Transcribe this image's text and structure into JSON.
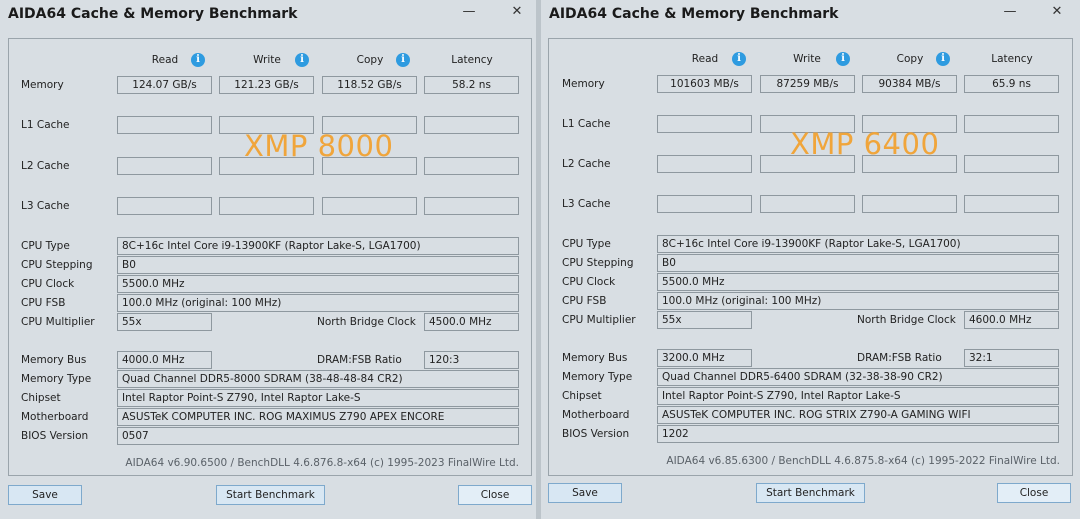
{
  "left": {
    "title": "AIDA64 Cache & Memory Benchmark",
    "minimize_glyph": "—",
    "close_glyph": "✕",
    "headers": {
      "read": "Read",
      "write": "Write",
      "copy": "Copy",
      "latency": "Latency"
    },
    "info_glyph": "i",
    "rows": {
      "memory": "Memory",
      "l1": "L1 Cache",
      "l2": "L2 Cache",
      "l3": "L3 Cache"
    },
    "memory": {
      "read": "124.07 GB/s",
      "write": "121.23 GB/s",
      "copy": "118.52 GB/s",
      "latency": "58.2 ns"
    },
    "overlay": "XMP 8000",
    "info_labels": {
      "cpu_type": "CPU Type",
      "cpu_stepping": "CPU Stepping",
      "cpu_clock": "CPU Clock",
      "cpu_fsb": "CPU FSB",
      "cpu_multiplier": "CPU Multiplier",
      "north_bridge": "North Bridge Clock",
      "memory_bus": "Memory Bus",
      "dram_fsb": "DRAM:FSB Ratio",
      "memory_type": "Memory Type",
      "chipset": "Chipset",
      "motherboard": "Motherboard",
      "bios": "BIOS Version"
    },
    "info_values": {
      "cpu_type": "8C+16c Intel Core i9-13900KF  (Raptor Lake-S, LGA1700)",
      "cpu_stepping": "B0",
      "cpu_clock": "5500.0 MHz",
      "cpu_fsb": "100.0 MHz  (original: 100 MHz)",
      "cpu_multiplier": "55x",
      "north_bridge": "4500.0 MHz",
      "memory_bus": "4000.0 MHz",
      "dram_fsb": "120:3",
      "memory_type": "Quad Channel DDR5-8000 SDRAM  (38-48-48-84 CR2)",
      "chipset": "Intel Raptor Point-S Z790, Intel Raptor Lake-S",
      "motherboard": "ASUSTeK COMPUTER INC. ROG MAXIMUS Z790 APEX ENCORE",
      "bios": "0507"
    },
    "footer": "AIDA64 v6.90.6500 / BenchDLL 4.6.876.8-x64  (c) 1995-2023 FinalWire Ltd.",
    "buttons": {
      "save": "Save",
      "start": "Start Benchmark",
      "close": "Close"
    }
  },
  "right": {
    "title": "AIDA64 Cache & Memory Benchmark",
    "minimize_glyph": "—",
    "close_glyph": "✕",
    "headers": {
      "read": "Read",
      "write": "Write",
      "copy": "Copy",
      "latency": "Latency"
    },
    "info_glyph": "i",
    "rows": {
      "memory": "Memory",
      "l1": "L1 Cache",
      "l2": "L2 Cache",
      "l3": "L3 Cache"
    },
    "memory": {
      "read": "101603 MB/s",
      "write": "87259 MB/s",
      "copy": "90384 MB/s",
      "latency": "65.9 ns"
    },
    "overlay": "XMP 6400",
    "info_labels": {
      "cpu_type": "CPU Type",
      "cpu_stepping": "CPU Stepping",
      "cpu_clock": "CPU Clock",
      "cpu_fsb": "CPU FSB",
      "cpu_multiplier": "CPU Multiplier",
      "north_bridge": "North Bridge Clock",
      "memory_bus": "Memory Bus",
      "dram_fsb": "DRAM:FSB Ratio",
      "memory_type": "Memory Type",
      "chipset": "Chipset",
      "motherboard": "Motherboard",
      "bios": "BIOS Version"
    },
    "info_values": {
      "cpu_type": "8C+16c Intel Core i9-13900KF  (Raptor Lake-S, LGA1700)",
      "cpu_stepping": "B0",
      "cpu_clock": "5500.0 MHz",
      "cpu_fsb": "100.0 MHz  (original: 100 MHz)",
      "cpu_multiplier": "55x",
      "north_bridge": "4600.0 MHz",
      "memory_bus": "3200.0 MHz",
      "dram_fsb": "32:1",
      "memory_type": "Quad Channel DDR5-6400 SDRAM  (32-38-38-90 CR2)",
      "chipset": "Intel Raptor Point-S Z790, Intel Raptor Lake-S",
      "motherboard": "ASUSTeK COMPUTER INC. ROG STRIX Z790-A GAMING WIFI",
      "bios": "1202"
    },
    "footer": "AIDA64 v6.85.6300 / BenchDLL 4.6.875.8-x64  (c) 1995-2022 FinalWire Ltd.",
    "buttons": {
      "save": "Save",
      "start": "Start Benchmark",
      "close": "Close"
    }
  }
}
